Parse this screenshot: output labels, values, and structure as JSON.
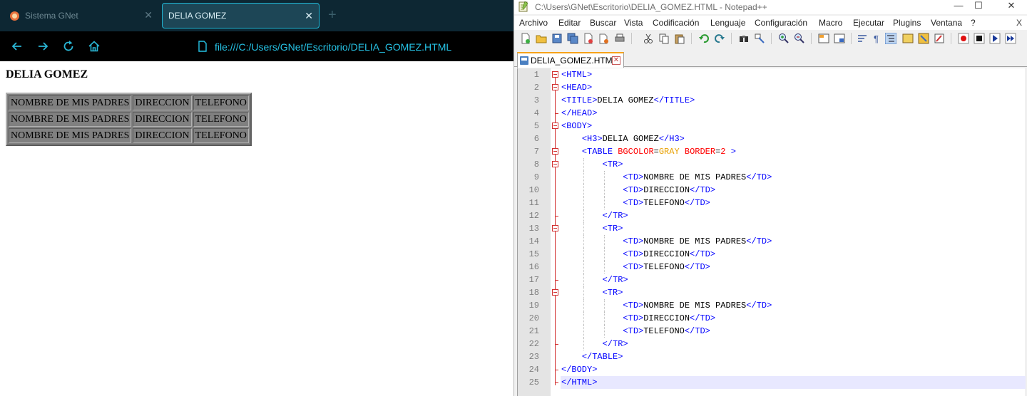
{
  "browser": {
    "tabs": [
      {
        "label": "Sistema GNet",
        "active": false
      },
      {
        "label": "DELIA GOMEZ",
        "active": true
      }
    ],
    "url": "file:///C:/Users/GNet/Escritorio/DELIA_GOMEZ.HTML",
    "page": {
      "heading": "DELIA GOMEZ",
      "table_rows": [
        [
          "NOMBRE DE MIS PADRES",
          "DIRECCION",
          "TELEFONO"
        ],
        [
          "NOMBRE DE MIS PADRES",
          "DIRECCION",
          "TELEFONO"
        ],
        [
          "NOMBRE DE MIS PADRES",
          "DIRECCION",
          "TELEFONO"
        ]
      ],
      "table_bgcolor": "#808080"
    },
    "colors": {
      "tabbar": "#0d2733",
      "accent": "#1fb6d4",
      "url": "#26c3e6"
    }
  },
  "notepad": {
    "title": "C:\\Users\\GNet\\Escritorio\\DELIA_GOMEZ.HTML - Notepad++",
    "menu": [
      "Archivo",
      "Editar",
      "Buscar",
      "Vista",
      "Codificación",
      "Lenguaje",
      "Configuración",
      "Macro",
      "Ejecutar",
      "Plugins",
      "Ventana",
      "?"
    ],
    "menu_close": "X",
    "doc_tab": "DELIA_GOMEZ.HTML",
    "current_line": 25,
    "lines": [
      {
        "n": "1",
        "segs": [
          [
            "tag",
            "<HTML>"
          ]
        ]
      },
      {
        "n": "2",
        "segs": [
          [
            "tag",
            "<HEAD>"
          ]
        ]
      },
      {
        "n": "3",
        "segs": [
          [
            "tag",
            "<TITLE>"
          ],
          [
            "txt",
            "DELIA GOMEZ"
          ],
          [
            "tag",
            "</TITLE>"
          ]
        ]
      },
      {
        "n": "4",
        "segs": [
          [
            "tag",
            "</HEAD>"
          ]
        ]
      },
      {
        "n": "5",
        "segs": [
          [
            "tag",
            "<BODY>"
          ]
        ]
      },
      {
        "n": "6",
        "segs": [
          [
            "txt",
            "    "
          ],
          [
            "tag",
            "<H3>"
          ],
          [
            "txt",
            "DELIA GOMEZ"
          ],
          [
            "tag",
            "</H3>"
          ]
        ]
      },
      {
        "n": "7",
        "segs": [
          [
            "txt",
            "    "
          ],
          [
            "tag",
            "<TABLE "
          ],
          [
            "attr",
            "BGCOLOR"
          ],
          [
            "txt",
            "="
          ],
          [
            "val",
            "GRAY"
          ],
          [
            "txt",
            " "
          ],
          [
            "attr",
            "BORDER"
          ],
          [
            "txt",
            "="
          ],
          [
            "attr",
            "2"
          ],
          [
            "tag",
            " >"
          ]
        ]
      },
      {
        "n": "8",
        "segs": [
          [
            "txt",
            "        "
          ],
          [
            "tag",
            "<TR>"
          ]
        ]
      },
      {
        "n": "9",
        "segs": [
          [
            "txt",
            "            "
          ],
          [
            "tag",
            "<TD>"
          ],
          [
            "txt",
            "NOMBRE DE MIS PADRES"
          ],
          [
            "tag",
            "</TD>"
          ]
        ]
      },
      {
        "n": "10",
        "segs": [
          [
            "txt",
            "            "
          ],
          [
            "tag",
            "<TD>"
          ],
          [
            "txt",
            "DIRECCION"
          ],
          [
            "tag",
            "</TD>"
          ]
        ]
      },
      {
        "n": "11",
        "segs": [
          [
            "txt",
            "            "
          ],
          [
            "tag",
            "<TD>"
          ],
          [
            "txt",
            "TELEFONO"
          ],
          [
            "tag",
            "</TD>"
          ]
        ]
      },
      {
        "n": "12",
        "segs": [
          [
            "txt",
            "        "
          ],
          [
            "tag",
            "</TR>"
          ]
        ]
      },
      {
        "n": "13",
        "segs": [
          [
            "txt",
            "        "
          ],
          [
            "tag",
            "<TR>"
          ]
        ]
      },
      {
        "n": "14",
        "segs": [
          [
            "txt",
            "            "
          ],
          [
            "tag",
            "<TD>"
          ],
          [
            "txt",
            "NOMBRE DE MIS PADRES"
          ],
          [
            "tag",
            "</TD>"
          ]
        ]
      },
      {
        "n": "15",
        "segs": [
          [
            "txt",
            "            "
          ],
          [
            "tag",
            "<TD>"
          ],
          [
            "txt",
            "DIRECCION"
          ],
          [
            "tag",
            "</TD>"
          ]
        ]
      },
      {
        "n": "16",
        "segs": [
          [
            "txt",
            "            "
          ],
          [
            "tag",
            "<TD>"
          ],
          [
            "txt",
            "TELEFONO"
          ],
          [
            "tag",
            "</TD>"
          ]
        ]
      },
      {
        "n": "17",
        "segs": [
          [
            "txt",
            "        "
          ],
          [
            "tag",
            "</TR>"
          ]
        ]
      },
      {
        "n": "18",
        "segs": [
          [
            "txt",
            "        "
          ],
          [
            "tag",
            "<TR>"
          ]
        ]
      },
      {
        "n": "19",
        "segs": [
          [
            "txt",
            "            "
          ],
          [
            "tag",
            "<TD>"
          ],
          [
            "txt",
            "NOMBRE DE MIS PADRES"
          ],
          [
            "tag",
            "</TD>"
          ]
        ]
      },
      {
        "n": "20",
        "segs": [
          [
            "txt",
            "            "
          ],
          [
            "tag",
            "<TD>"
          ],
          [
            "txt",
            "DIRECCION"
          ],
          [
            "tag",
            "</TD>"
          ]
        ]
      },
      {
        "n": "21",
        "segs": [
          [
            "txt",
            "            "
          ],
          [
            "tag",
            "<TD>"
          ],
          [
            "txt",
            "TELEFONO"
          ],
          [
            "tag",
            "</TD>"
          ]
        ]
      },
      {
        "n": "22",
        "segs": [
          [
            "txt",
            "        "
          ],
          [
            "tag",
            "</TR>"
          ]
        ]
      },
      {
        "n": "23",
        "segs": [
          [
            "txt",
            "    "
          ],
          [
            "tag",
            "</TABLE>"
          ]
        ]
      },
      {
        "n": "24",
        "segs": [
          [
            "tag",
            "</BODY>"
          ]
        ]
      },
      {
        "n": "25",
        "segs": [
          [
            "tag",
            "</HTML>"
          ]
        ]
      }
    ],
    "colors": {
      "tag": "#0000ff",
      "attr": "#ff0000",
      "value": "#e8a000",
      "fold": "#d23030",
      "current_line_bg": "#e8e8ff",
      "tab_accent": "#f7a31a"
    }
  }
}
